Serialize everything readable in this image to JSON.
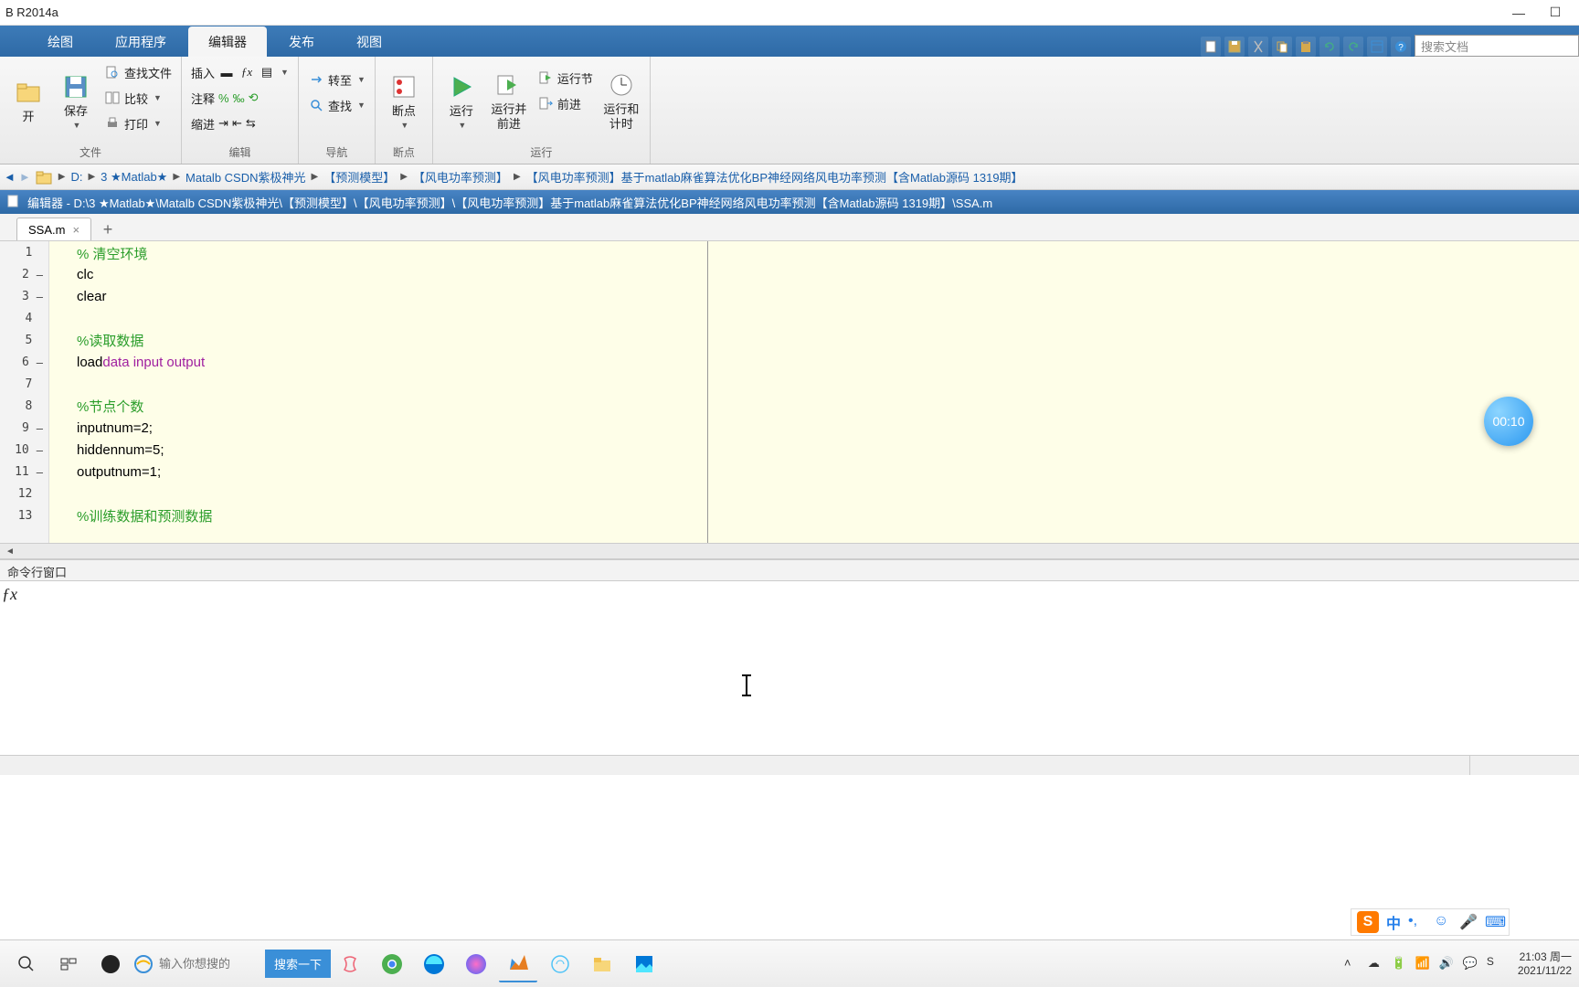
{
  "window": {
    "title": "B R2014a"
  },
  "tabs": {
    "t1": "绘图",
    "t2": "应用程序",
    "t3": "编辑器",
    "t4": "发布",
    "t5": "视图"
  },
  "search": {
    "placeholder": "搜索文档"
  },
  "ribbon": {
    "file": {
      "label": "文件",
      "open": "开",
      "save": "保存",
      "findfiles": "查找文件",
      "compare": "比较",
      "print": "打印"
    },
    "edit": {
      "label": "编辑",
      "insert": "插入",
      "comment": "注释",
      "indent": "缩进",
      "fx": "ƒx"
    },
    "nav": {
      "label": "导航",
      "goto": "转至",
      "find": "查找"
    },
    "bp": {
      "label": "断点",
      "breakpoints": "断点"
    },
    "run": {
      "label": "运行",
      "run": "运行",
      "runadv": "运行并\n前进",
      "runsec": "运行节",
      "adv": "前进",
      "runtime": "运行和\n计时"
    }
  },
  "path": {
    "drive": "D:",
    "p1": "3 ★Matlab★",
    "p2": "Matalb CSDN紫极神光",
    "p3": "【预测模型】",
    "p4": "【风电功率预测】",
    "p5": "【风电功率预测】基于matlab麻雀算法优化BP神经网络风电功率预测【含Matlab源码 1319期】"
  },
  "editor": {
    "title": "编辑器 - D:\\3 ★Matlab★\\Matalb CSDN紫极神光\\【预测模型】\\【风电功率预测】\\【风电功率预测】基于matlab麻雀算法优化BP神经网络风电功率预测【含Matlab源码 1319期】\\SSA.m",
    "tab": "SSA.m"
  },
  "code": {
    "l1": "% 清空环境",
    "l2": "clc",
    "l3": "clear",
    "l5": "%读取数据",
    "l6a": "load ",
    "l6b": "data input output",
    "l8": "%节点个数",
    "l9": "inputnum=2;",
    "l10": "hiddennum=5;",
    "l11": "outputnum=1;",
    "l13": "%训练数据和预测数据"
  },
  "cmd": {
    "title": "命令行窗口"
  },
  "timer": "00:10",
  "ime": {
    "cn": "中"
  },
  "taskbar": {
    "search_placeholder": "输入你想搜的",
    "search_btn": "搜索一下",
    "time": "21:03 周一",
    "date": "2021/11/22"
  }
}
